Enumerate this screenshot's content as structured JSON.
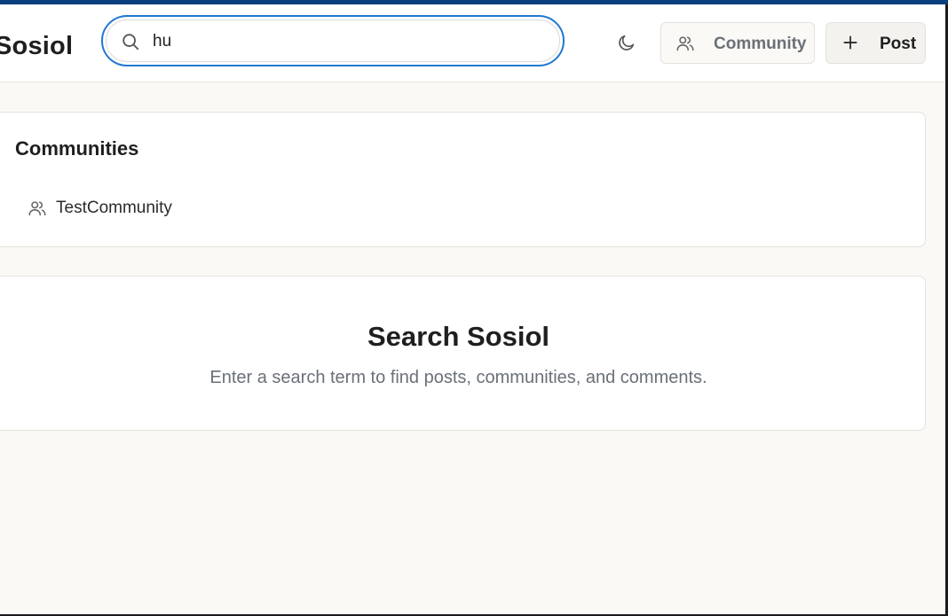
{
  "header": {
    "brand": "Sosiol",
    "search": {
      "value": "hu",
      "placeholder": ""
    },
    "icons": {
      "search": "search-icon",
      "theme": "moon-icon",
      "community": "users-icon",
      "post": "plus-icon"
    },
    "community_button_label": "Community",
    "post_button_label": "Post"
  },
  "communities": {
    "title": "Communities",
    "items": [
      {
        "label": "TestCommunity",
        "icon": "users-icon"
      }
    ]
  },
  "empty_state": {
    "title": "Search Sosiol",
    "subtitle": "Enter a search term to find posts, communities, and comments."
  },
  "colors": {
    "accent_bar": "#0b3f7e",
    "focus_ring": "#1f78d1",
    "page_background": "#faf9f5",
    "muted_text": "#6a7078"
  }
}
